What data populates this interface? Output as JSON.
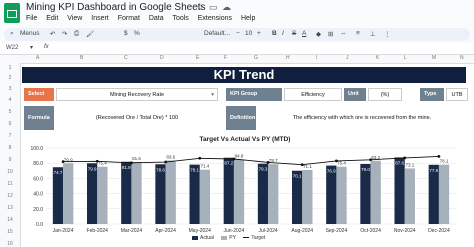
{
  "app": {
    "title": "Mining KPI Dashboard in Google Sheets",
    "menu": [
      "File",
      "Edit",
      "View",
      "Insert",
      "Format",
      "Data",
      "Tools",
      "Extensions",
      "Help"
    ],
    "toolbar": {
      "menus_label": "Menus",
      "font_label": "Default...",
      "font_size": "10"
    },
    "cell_ref": "W22"
  },
  "columns": [
    "A",
    "B",
    "C",
    "D",
    "E",
    "F",
    "G",
    "H",
    "I",
    "J",
    "K",
    "L",
    "M",
    "N"
  ],
  "rows": [
    "1",
    "2",
    "3",
    "4",
    "5",
    "6",
    "7",
    "8",
    "9",
    "10",
    "11",
    "12",
    "13",
    "14",
    "15",
    "16"
  ],
  "dashboard": {
    "banner": "KPI Trend",
    "select_kpi_label": "Select KPI",
    "select_kpi_value": "Mining Recovery Rate",
    "kpi_group_label": "KPI Group",
    "kpi_group_value": "Efficiency",
    "unit_label": "Unit",
    "unit_value": "(%)",
    "type_label": "Type",
    "type_value": "UTB",
    "formula_label": "Formula",
    "formula_value": "(Recovered Ore / Total Ore) * 100",
    "definition_label": "Definition",
    "definition_value": "The efficiency with which ore is recovered from the mine."
  },
  "chart_data": {
    "type": "bar",
    "title": "Target Vs Actual Vs PY (MTD)",
    "categories": [
      "Jan-2024",
      "Feb-2024",
      "Mar-2024",
      "Apr-2024",
      "May-2024",
      "Jun-2024",
      "Jul-2024",
      "Aug-2024",
      "Sep-2024",
      "Oct-2024",
      "Nov-2024",
      "Dec-2024"
    ],
    "y_ticks": [
      "100.0",
      "80.0",
      "60.0",
      "40.0",
      "20.0",
      "0.0"
    ],
    "ylim": [
      0,
      100
    ],
    "series": [
      {
        "name": "Actual",
        "kind": "bar",
        "color": "#1a2b49",
        "values": [
          74.7,
          79.9,
          81.9,
          78.6,
          78.1,
          87.2,
          79.3,
          70.1,
          76.9,
          79.0,
          87.6,
          77.9
        ]
      },
      {
        "name": "PY",
        "kind": "bar",
        "color": "#a6b1bc",
        "values": [
          79.9,
          75.4,
          81.6,
          83.6,
          71.4,
          84.8,
          78.7,
          71.1,
          75.4,
          83.2,
          73.1,
          78.1
        ]
      },
      {
        "name": "Target",
        "kind": "line",
        "color": "#111111",
        "values": [
          82.0,
          82.5,
          80.5,
          81.5,
          86.5,
          85.5,
          81.0,
          78.0,
          83.0,
          84.5,
          87.0,
          89.0
        ]
      }
    ],
    "data_labels": [
      [
        "74.7",
        "79.9"
      ],
      [
        "79.9",
        "75.4"
      ],
      [
        "81.9",
        "81.6"
      ],
      [
        "78.6",
        "83.6"
      ],
      [
        "78.1",
        "71.4"
      ],
      [
        "87.2",
        "84.8"
      ],
      [
        "79.3",
        "78.7"
      ],
      [
        "70.1",
        "71.1"
      ],
      [
        "76.9",
        "75.4"
      ],
      [
        "79.0",
        "83.2"
      ],
      [
        "87.6",
        "73.1"
      ],
      [
        "77.9",
        "78.1"
      ]
    ],
    "legend": [
      "Actual",
      "PY",
      "Target"
    ],
    "legend_position": "bottom"
  }
}
